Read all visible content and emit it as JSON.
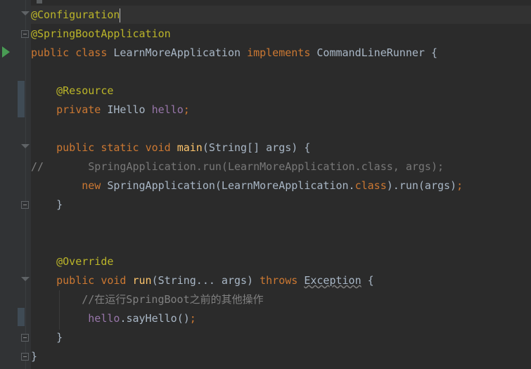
{
  "editor": {
    "lines": [
      {
        "id": "l1",
        "tokens": [
          {
            "t": "@Configuration",
            "c": "ann"
          }
        ]
      },
      {
        "id": "l2",
        "tokens": [
          {
            "t": "@SpringBootApplication",
            "c": "ann"
          }
        ]
      },
      {
        "id": "l3",
        "tokens": [
          {
            "t": "public ",
            "c": "kw"
          },
          {
            "t": "class ",
            "c": "kw"
          },
          {
            "t": "LearnMoreApplication ",
            "c": "plain"
          },
          {
            "t": "implements ",
            "c": "kw"
          },
          {
            "t": "CommandLineRunner {",
            "c": "plain"
          }
        ]
      },
      {
        "id": "l4",
        "tokens": []
      },
      {
        "id": "l5",
        "tokens": [
          {
            "t": "    ",
            "c": "plain"
          },
          {
            "t": "@Resource",
            "c": "ann"
          }
        ]
      },
      {
        "id": "l6",
        "tokens": [
          {
            "t": "    ",
            "c": "plain"
          },
          {
            "t": "private ",
            "c": "kw"
          },
          {
            "t": "IHello ",
            "c": "plain"
          },
          {
            "t": "hello",
            "c": "fld"
          },
          {
            "t": ";",
            "c": "semi"
          }
        ]
      },
      {
        "id": "l7",
        "tokens": []
      },
      {
        "id": "l8",
        "tokens": [
          {
            "t": "    ",
            "c": "plain"
          },
          {
            "t": "public ",
            "c": "kw"
          },
          {
            "t": "static ",
            "c": "kw"
          },
          {
            "t": "void ",
            "c": "kw"
          },
          {
            "t": "main",
            "c": "fn"
          },
          {
            "t": "(String[] args) {",
            "c": "plain"
          }
        ]
      },
      {
        "id": "l9",
        "tokens": [
          {
            "t": "//",
            "c": "cmt"
          },
          {
            "t": "       SpringApplication.run(LearnMoreApplication.class, args);",
            "c": "dim"
          }
        ]
      },
      {
        "id": "l10",
        "tokens": [
          {
            "t": "        ",
            "c": "plain"
          },
          {
            "t": "new ",
            "c": "kw"
          },
          {
            "t": "SpringApplication(LearnMoreApplication.",
            "c": "plain"
          },
          {
            "t": "class",
            "c": "kw"
          },
          {
            "t": ").run(args)",
            "c": "plain"
          },
          {
            "t": ";",
            "c": "semi"
          }
        ]
      },
      {
        "id": "l11",
        "tokens": [
          {
            "t": "    }",
            "c": "plain"
          }
        ]
      },
      {
        "id": "l12",
        "tokens": []
      },
      {
        "id": "l13",
        "tokens": []
      },
      {
        "id": "l14",
        "tokens": [
          {
            "t": "    ",
            "c": "plain"
          },
          {
            "t": "@Override",
            "c": "ann"
          }
        ]
      },
      {
        "id": "l15",
        "tokens": [
          {
            "t": "    ",
            "c": "plain"
          },
          {
            "t": "public ",
            "c": "kw"
          },
          {
            "t": "void ",
            "c": "kw"
          },
          {
            "t": "run",
            "c": "fn"
          },
          {
            "t": "(String... args) ",
            "c": "plain"
          },
          {
            "t": "throws ",
            "c": "kw"
          },
          {
            "t": "Exception",
            "c": "exc"
          },
          {
            "t": " {",
            "c": "plain"
          }
        ]
      },
      {
        "id": "l16",
        "tokens": [
          {
            "t": "        ",
            "c": "plain"
          },
          {
            "t": "//在运行SpringBoot之前的其他操作",
            "c": "cmt"
          }
        ]
      },
      {
        "id": "l17",
        "tokens": [
          {
            "t": "         ",
            "c": "plain"
          },
          {
            "t": "hello",
            "c": "fld"
          },
          {
            "t": ".sayHello()",
            "c": "plain"
          },
          {
            "t": ";",
            "c": "semi"
          }
        ]
      },
      {
        "id": "l18",
        "tokens": [
          {
            "t": "    }",
            "c": "plain"
          }
        ]
      },
      {
        "id": "l19",
        "tokens": [
          {
            "t": "}",
            "c": "plain"
          }
        ]
      }
    ]
  },
  "colors": {
    "background": "#2b2b2b",
    "gutter": "#313335",
    "keyword": "#cc7832",
    "annotation": "#bbb529",
    "field": "#9876aa",
    "method": "#ffc66d",
    "comment": "#808080",
    "text": "#a9b7c6"
  },
  "icons": {
    "run": "run-gutter-icon",
    "fold": "fold-marker-icon"
  }
}
